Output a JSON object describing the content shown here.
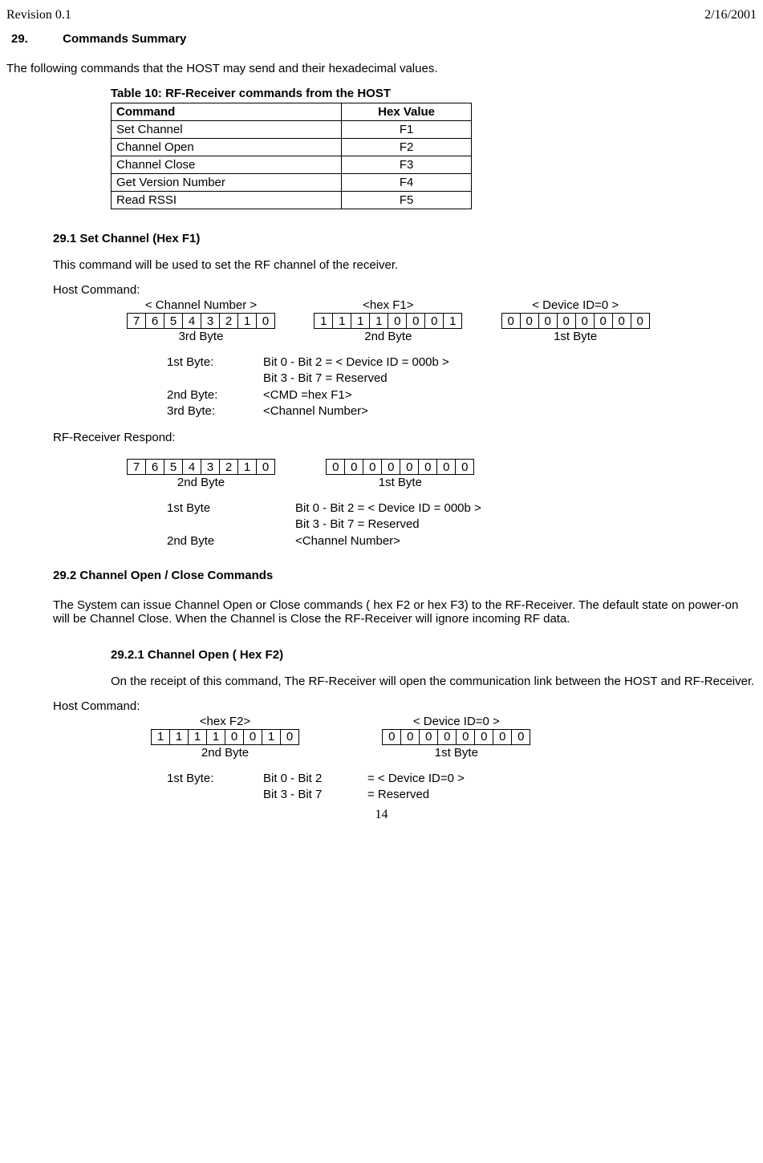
{
  "header": {
    "left": "Revision 0.1",
    "right": "2/16/2001"
  },
  "section": {
    "num": "29.",
    "title": "Commands Summary"
  },
  "intro": "The following commands that the HOST may send and their hexadecimal values.",
  "table10": {
    "caption_prefix": "Table 10",
    "caption_rest": ": RF-Receiver commands from the HOST",
    "col1": "Command",
    "col2": "Hex Value",
    "rows": [
      {
        "cmd": "Set Channel",
        "hex": "F1"
      },
      {
        "cmd": "Channel Open",
        "hex": "F2"
      },
      {
        "cmd": "Channel Close",
        "hex": "F3"
      },
      {
        "cmd": "Get Version Number",
        "hex": "F4"
      },
      {
        "cmd": "Read RSSI",
        "hex": "F5"
      }
    ]
  },
  "s291": {
    "title": "29.1 Set Channel (Hex F1)",
    "desc": "This command will be used to set the RF channel of the receiver.",
    "hostcmd": "Host Command:",
    "g3": {
      "above": "< Channel Number >",
      "bits": [
        "7",
        "6",
        "5",
        "4",
        "3",
        "2",
        "1",
        "0"
      ],
      "below": "3rd Byte"
    },
    "g2": {
      "above": "<hex F1>",
      "bits": [
        "1",
        "1",
        "1",
        "1",
        "0",
        "0",
        "0",
        "1"
      ],
      "below": "2nd Byte"
    },
    "g1": {
      "above": "< Device ID=0 >",
      "bits": [
        "0",
        "0",
        "0",
        "0",
        "0",
        "0",
        "0",
        "0"
      ],
      "below": "1st Byte"
    },
    "d1a": "1st Byte:",
    "d1b": "Bit 0 - Bit 2 = < Device ID = 000b >",
    "d1c": "Bit 3 - Bit 7 = Reserved",
    "d2a": "2nd Byte:",
    "d2b": "<CMD =hex F1>",
    "d3a": "3rd Byte:",
    "d3b": "<Channel Number>",
    "resp": "RF-Receiver Respond:",
    "r2": {
      "bits": [
        "7",
        "6",
        "5",
        "4",
        "3",
        "2",
        "1",
        "0"
      ],
      "below": "2nd Byte"
    },
    "r1": {
      "bits": [
        "0",
        "0",
        "0",
        "0",
        "0",
        "0",
        "0",
        "0"
      ],
      "below": "1st Byte"
    },
    "rd1a": "1st Byte",
    "rd1b": "Bit 0 - Bit 2 = < Device ID = 000b >",
    "rd1c": "Bit 3 - Bit 7 = Reserved",
    "rd2a": "2nd Byte",
    "rd2b": "<Channel Number>"
  },
  "s292": {
    "title": "29.2 Channel Open / Close Commands",
    "para": "The System can issue Channel Open or Close commands ( hex F2 or hex F3) to the RF-Receiver. The default state on power-on will be Channel Close. When the Channel is Close the RF-Receiver will ignore incoming RF data."
  },
  "s2921": {
    "title": "29.2.1 Channel Open ( Hex F2)",
    "para": "On the receipt of this command, The RF-Receiver will open the communication link between the HOST and RF-Receiver.",
    "hostcmd": "Host Command:",
    "g2": {
      "above": "<hex F2>",
      "bits": [
        "1",
        "1",
        "1",
        "1",
        "0",
        "0",
        "1",
        "0"
      ],
      "below": "2nd Byte"
    },
    "g1": {
      "above": "< Device ID=0 >",
      "bits": [
        "0",
        "0",
        "0",
        "0",
        "0",
        "0",
        "0",
        "0"
      ],
      "below": "1st Byte"
    },
    "d1a": "1st Byte:",
    "d1b1": "Bit 0 - Bit 2",
    "d1b2": "= < Device ID=0 >",
    "d1c1": "Bit 3 - Bit 7",
    "d1c2": " = Reserved"
  },
  "pagenum": "14"
}
